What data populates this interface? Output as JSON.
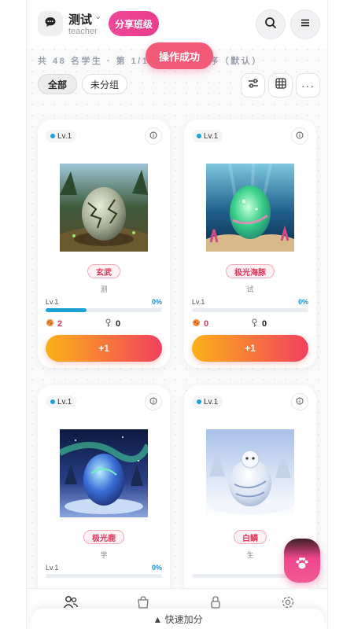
{
  "header": {
    "class_name": "测试",
    "role": "teacher",
    "share_label": "分享班级"
  },
  "toast": "操作成功",
  "summary": "共 48 名学生 · 第 1/1 页 · 座位顺序（默认）",
  "filters": {
    "all": "全部",
    "ungrouped": "未分组"
  },
  "cards": [
    {
      "level": "Lv.1",
      "pet": "玄武",
      "student": "测",
      "prog_label": "Lv.1",
      "percent": "0%",
      "progress": 0.35,
      "food": "2",
      "keys": "0",
      "plus": "+1"
    },
    {
      "level": "Lv.1",
      "pet": "极光海豚",
      "student": "试",
      "prog_label": "Lv.1",
      "percent": "0%",
      "progress": 0,
      "food": "0",
      "keys": "0",
      "plus": "+1"
    },
    {
      "level": "Lv.1",
      "pet": "极光鹿",
      "student": "学",
      "prog_label": "Lv.1",
      "percent": "0%",
      "progress": 0,
      "food": "",
      "keys": "",
      "plus": ""
    },
    {
      "level": "Lv.1",
      "pet": "白鳞",
      "student": "生",
      "prog_label": "",
      "percent": "",
      "progress": 0,
      "food": "",
      "keys": "",
      "plus": ""
    }
  ],
  "quick_bar": "▲ 快速加分",
  "colors": {
    "accent_pink": "#f0479a",
    "level_blue": "#1aa3d4",
    "button_gradient_start": "#fbb117",
    "button_gradient_end": "#f2405f"
  },
  "icons": [
    "chat-bubble-icon",
    "search-icon",
    "menu-icon",
    "sliders-icon",
    "grid-icon",
    "more-icon",
    "info-icon",
    "food-icon",
    "key-icon",
    "paw-icon",
    "students-icon",
    "shop-icon",
    "lock-icon",
    "settings-icon"
  ]
}
